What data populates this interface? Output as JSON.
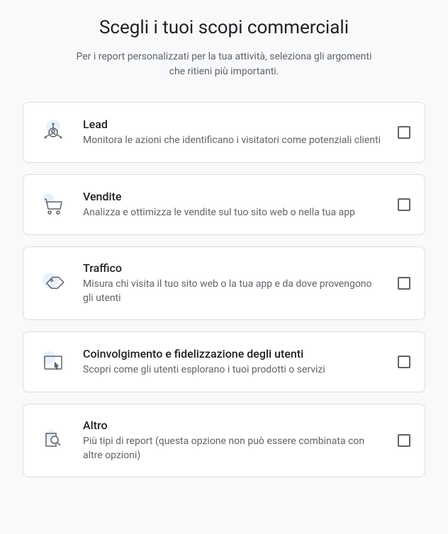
{
  "header": {
    "title": "Scegli i tuoi scopi commerciali",
    "subtitle": "Per i report personalizzati per la tua attività, seleziona gli argomenti che ritieni più importanti."
  },
  "options": [
    {
      "title": "Lead",
      "desc": "Monitora le azioni che identificano i visitatori come potenziali clienti"
    },
    {
      "title": "Vendite",
      "desc": "Analizza e ottimizza le vendite sul tuo sito web o nella tua app"
    },
    {
      "title": "Traffico",
      "desc": "Misura chi visita il tuo sito web o la tua app e da dove provengono gli utenti"
    },
    {
      "title": "Coinvolgimento e fidelizzazione degli utenti",
      "desc": "Scopri come gli utenti esplorano i tuoi prodotti o servizi"
    },
    {
      "title": "Altro",
      "desc": "Più tipi di report (questa opzione non può essere combinata con altre opzioni)"
    }
  ]
}
